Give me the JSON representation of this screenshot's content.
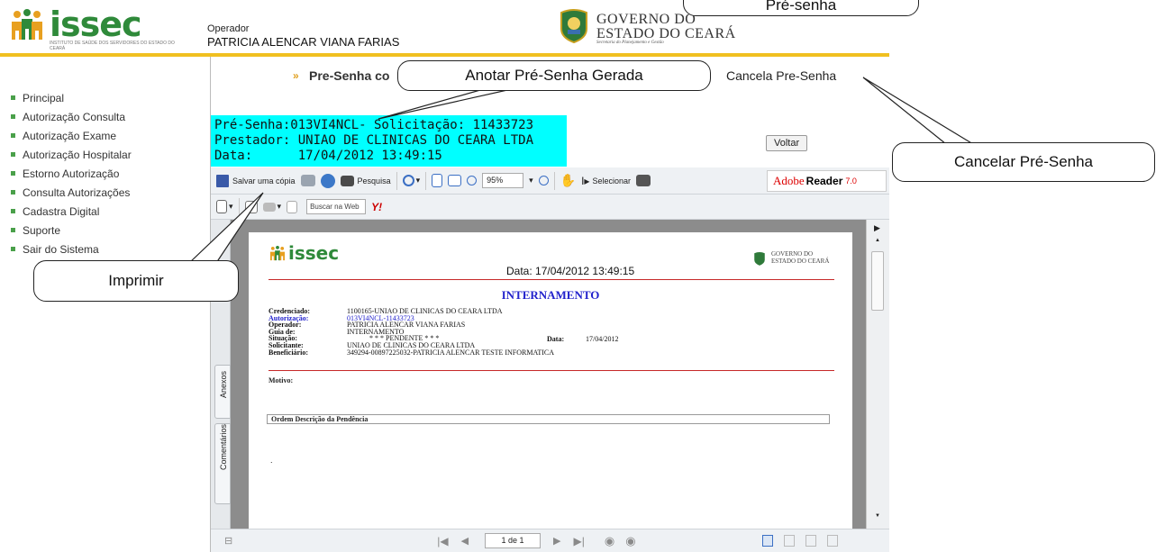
{
  "header": {
    "logo_text": "issec",
    "logo_subtext": "INSTITUTO DE SAÚDE DOS SERVIDORES DO ESTADO DO CEARÁ",
    "operator_label": "Operador",
    "operator_name": "PATRICIA ALENCAR VIANA FARIAS",
    "gov_line1": "GOVERNO DO",
    "gov_line2": "ESTADO DO CEARÁ",
    "gov_line3": "Secretaria do Planejamento e Gestão",
    "accent_color": "#f0c020"
  },
  "sidebar": {
    "items": [
      {
        "label": "Principal"
      },
      {
        "label": "Autorização Consulta"
      },
      {
        "label": "Autorização Exame"
      },
      {
        "label": "Autorização Hospitalar"
      },
      {
        "label": "Estorno Autorização"
      },
      {
        "label": "Consulta Autorizações"
      },
      {
        "label": "Cadastra Digital"
      },
      {
        "label": "Suporte"
      },
      {
        "label": "Sair do Sistema"
      }
    ]
  },
  "content": {
    "title_arrow": "»",
    "title": "Pre-Senha co",
    "cancel_link": "Cancela Pre-Senha",
    "cyan_line1": "Pré-Senha:013VI4NCL- Solicitação: 11433723",
    "cyan_line2": "Prestador: UNIAO DE CLINICAS DO CEARA LTDA",
    "cyan_line3": "Data:      17/04/2012 13:49:15",
    "voltar_label": "Voltar",
    "highlight_color": "#00ffff"
  },
  "reader": {
    "save_label": "Salvar uma cópia",
    "search_label": "Pesquisa",
    "zoom_value": "95%",
    "select_label": "Selecionar",
    "adobe_text1": "Adobe",
    "adobe_text2": "Reader",
    "adobe_version": "7.0",
    "web_search_placeholder": "Buscar na Web",
    "yahoo_text": "Y!",
    "tab_annexes": "Anexos",
    "tab_comments": "Comentários",
    "page_indicator": "1 de 1",
    "icons": [
      "save-icon",
      "print-icon",
      "email-icon",
      "binoculars-icon",
      "zoom-in-icon",
      "fit-page-icon",
      "fit-width-icon",
      "zoom-out-icon",
      "zoom-plus-icon",
      "hand-icon",
      "select-icon",
      "snapshot-icon"
    ]
  },
  "document": {
    "logo_text": "issec",
    "date_text": "Data: 17/04/2012 13:49:15",
    "gov_line1": "GOVERNO DO",
    "gov_line2": "ESTADO DO CEARÁ",
    "title": "INTERNAMENTO",
    "fields": [
      {
        "key": "Credenciado:",
        "value": "1100165-UNIAO DE CLINICAS DO CEARA LTDA",
        "blue": false
      },
      {
        "key": "Autorização:",
        "value": "013VI4NCL-11433723",
        "blue": true
      },
      {
        "key": "Operador:",
        "value": "PATRICIA ALENCAR VIANA FARIAS",
        "blue": false
      },
      {
        "key": "Guia de:",
        "value": "INTERNAMENTO",
        "blue": false
      },
      {
        "key": "Situação:",
        "value": "* * * PENDENTE * * *",
        "blue": false
      },
      {
        "key": "Solicitante:",
        "value": "UNIAO DE CLINICAS DO CEARA LTDA",
        "blue": false
      },
      {
        "key": "Beneficiário:",
        "value": "349294-00897225032-PATRICIA ALENCAR TESTE INFORMATICA",
        "blue": false
      }
    ],
    "data_key": "Data:",
    "data_value": "17/04/2012",
    "motivo": "Motivo:",
    "table_header": "Ordem   Descrição da Pendência",
    "dot": "."
  },
  "callouts": {
    "top_partial": "Pré-senha",
    "anotar": "Anotar Pré-Senha Gerada",
    "cancelar": "Cancelar Pré-Senha",
    "imprimir": "Imprimir"
  }
}
